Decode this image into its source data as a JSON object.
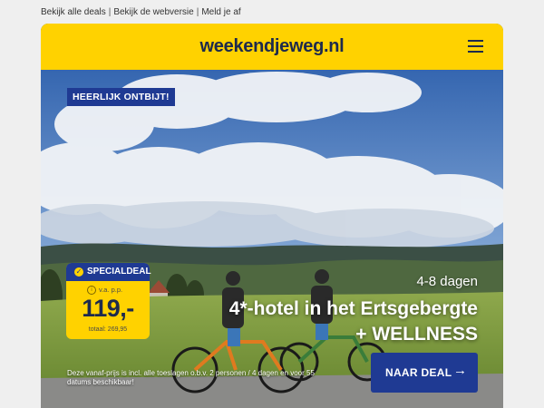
{
  "top_links": {
    "all_deals": "Bekijk alle deals",
    "web_version": "Bekijk de webversie",
    "unsubscribe": "Meld je af",
    "separator": "|"
  },
  "header": {
    "logo": "weekendjeweg.nl",
    "menu_icon": "hamburger-menu-icon",
    "background": "#ffd200"
  },
  "hero": {
    "tag": "HEERLIJK ONTBIJT!",
    "duration": "4-8 dagen",
    "headline_line1": "4*-hotel in het Ertsgebergte",
    "headline_line2": "+ WELLNESS",
    "disclaimer": "Deze vanaf-prijs is incl. alle toeslagen o.b.v. 2 personen / 4 dagen en voor 55 datums beschikbaar!"
  },
  "special_deal": {
    "label": "SPECIALDEAL",
    "check_icon": "check-circle-icon",
    "info_icon": "info-icon",
    "per_person": "v.a. p.p.",
    "price": "119,-",
    "total": "totaal: 269,95"
  },
  "cta": {
    "label": "NAAR DEAL",
    "arrow": "→",
    "arrow_icon": "arrow-right-icon"
  },
  "colors": {
    "brand_yellow": "#ffd200",
    "brand_blue": "#1f3a93",
    "logo_text": "#1d2a4d"
  }
}
